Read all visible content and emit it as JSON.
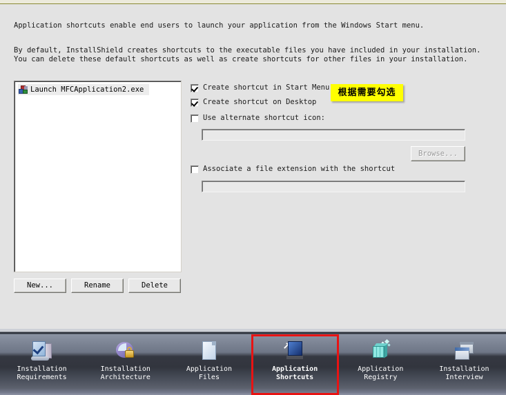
{
  "page": {
    "description_line_1": "Application shortcuts enable end users to launch your application from the Windows Start menu.",
    "description_line_2": "By default, InstallShield creates shortcuts to the executable files you have included in your installation.\nYou can delete these default shortcuts as well as create shortcuts for other files in your installation."
  },
  "shortcut_list": {
    "items": [
      {
        "icon": "shortcut-application-icon",
        "label": "Launch MFCApplication2.exe",
        "selected": true
      }
    ],
    "buttons": {
      "new": "New...",
      "rename": "Rename",
      "delete": "Delete"
    }
  },
  "options": {
    "create_start_menu": {
      "label": "Create shortcut in Start Menu",
      "checked": true
    },
    "create_desktop": {
      "label": "Create shortcut on Desktop",
      "checked": true
    },
    "use_alternate_icon": {
      "label": "Use alternate shortcut icon:",
      "checked": false
    },
    "associate_extension": {
      "label": "Associate a file extension with the shortcut",
      "checked": false
    },
    "icon_path_value": "",
    "icon_path_placeholder": "",
    "extension_value": "",
    "extension_placeholder": "",
    "browse_label": "Browse..."
  },
  "annotation": {
    "text": "根据需要勾选",
    "background": "#ffff00",
    "color": "#000000"
  },
  "navbar": {
    "selection_color": "#e81313",
    "items": [
      {
        "icon": "installation-requirements-icon",
        "label": "Installation\nRequirements",
        "selected": false
      },
      {
        "icon": "installation-architecture-icon",
        "label": "Installation\nArchitecture",
        "selected": false
      },
      {
        "icon": "application-files-icon",
        "label": "Application\nFiles",
        "selected": false
      },
      {
        "icon": "application-shortcuts-icon",
        "label": "Application\nShortcuts",
        "selected": true
      },
      {
        "icon": "application-registry-icon",
        "label": "Application\nRegistry",
        "selected": false
      },
      {
        "icon": "installation-interview-icon",
        "label": "Installation\nInterview",
        "selected": false
      }
    ]
  }
}
